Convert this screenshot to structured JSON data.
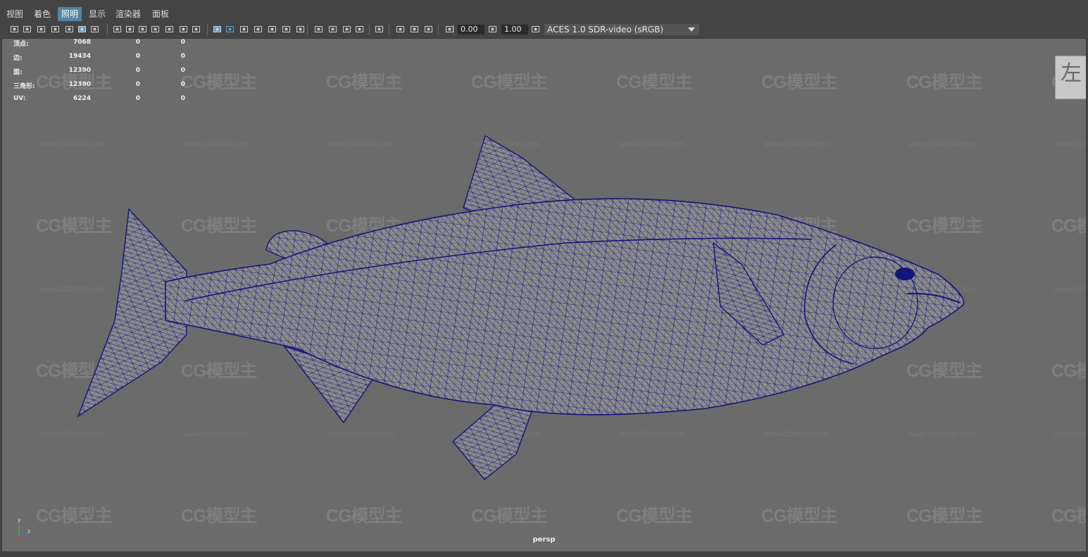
{
  "menu": [
    "视图",
    "着色",
    "照明",
    "显示",
    "渲染器",
    "面板"
  ],
  "active_menu_index": 2,
  "toolbar": {
    "icons": [
      "camera-icon",
      "camera-attr-icon",
      "bookmark-icon",
      "image-plane-icon",
      "pan-zoom-icon",
      "grease-pencil-icon",
      "grid-icon",
      "film-gate-icon",
      "resolution-gate-icon",
      "gate-mask-icon",
      "field-chart-icon",
      "safe-action-icon",
      "safe-title-icon",
      "wireframe-icon",
      "smooth-shade-icon",
      "default-material-icon",
      "wireframe-on-shaded-icon",
      "textured-icon",
      "use-all-lights-icon",
      "shadows-icon",
      "screen-space-ao-icon",
      "motion-blur-icon",
      "multisample-aa-icon",
      "depth-of-field-icon",
      "isolate-select-icon",
      "xray-icon",
      "xray-active-icon",
      "xray-joints-icon",
      "backface-culling-icon",
      "exposure-icon",
      "gamma-icon",
      "color-management-icon"
    ],
    "exposure_value": "0.00",
    "gamma_value": "1.00",
    "color_space": "ACES 1.0 SDR-video (sRGB)"
  },
  "hud": {
    "rows": [
      {
        "label": "顶点:",
        "values": [
          "7068",
          "0",
          "0"
        ]
      },
      {
        "label": "边:",
        "values": [
          "19434",
          "0",
          "0"
        ]
      },
      {
        "label": "面:",
        "values": [
          "12390",
          "0",
          "0"
        ]
      },
      {
        "label": "三角形:",
        "values": [
          "12390",
          "0",
          "0"
        ]
      },
      {
        "label": "UV:",
        "values": [
          "6224",
          "0",
          "0"
        ]
      }
    ]
  },
  "watermark": {
    "logo": "CG模型主",
    "url": "www.CGMXW.com"
  },
  "view_cube_label": "左",
  "axis": {
    "y": "y",
    "z": "z"
  },
  "camera_label": "persp",
  "colors": {
    "viewport_bg": "#6b6b6b",
    "wire": "#14147a",
    "mesh_fill": "#8c8c8c",
    "menu_active": "#5285a6"
  }
}
